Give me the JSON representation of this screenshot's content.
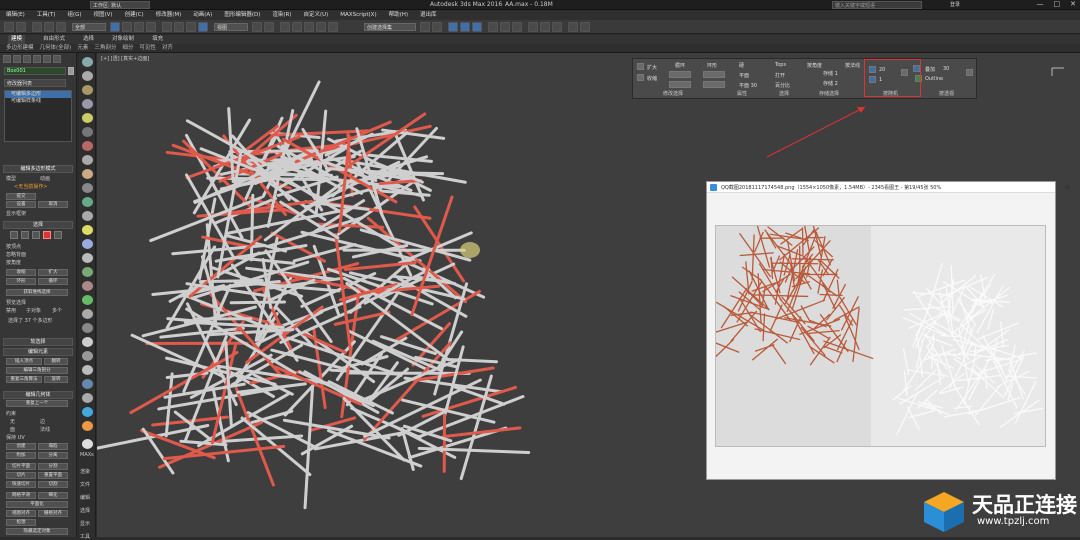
{
  "window": {
    "app_title": "Autodesk 3ds Max 2016",
    "file_title": "AA.max - 0.18M",
    "workspace": "工作区: 默认",
    "search_placeholder": "键入关键字或短语",
    "user": "登录",
    "controls": [
      "—",
      "□",
      "✕"
    ]
  },
  "menu": {
    "items": [
      "编辑(E)",
      "工具(T)",
      "组(G)",
      "视图(V)",
      "创建(C)",
      "修改器(M)",
      "动画(A)",
      "图形编辑器(D)",
      "渲染(R)",
      "自定义(U)",
      "MAXScript(X)",
      "帮助(H)",
      "退出库"
    ]
  },
  "toolbar": {
    "selection_filter": "全部",
    "view_select": "视图",
    "named_selection": "创建选择集"
  },
  "ribbon": {
    "tabs": [
      "建模",
      "自由形式",
      "选择",
      "对象绘制",
      "填充"
    ],
    "active_tab": "建模",
    "subtabs": [
      "多边形建模",
      "几何体(全部)",
      "元素",
      "三角剖分",
      "细分",
      "可见性",
      "对齐"
    ],
    "panel": {
      "expand": "扩大",
      "shrink": "收缩",
      "loop": "循环",
      "ring": "环形",
      "tops": "Tops",
      "open": "打开",
      "save1": "存储 1",
      "save2": "存储 2",
      "plane": "平面",
      "plane_30": "平面 30",
      "hard": "硬",
      "by_angle": "按角度",
      "by_normal": "按法线",
      "stretch": "百分比",
      "auto_value_1": "20",
      "auto_value_2": "1",
      "outline_value": "30",
      "outline": "Outline",
      "overlap": "叠加",
      "group_labels": [
        "修改选择",
        "属性",
        "选择",
        "存储选择",
        "按随机",
        "按透视"
      ]
    }
  },
  "command_panel": {
    "object_name": "Box001",
    "modifier_list": "修改器列表",
    "stack": [
      "可编辑多边形",
      "可编辑样条线"
    ],
    "edit_poly_mode": "编辑多边形模式",
    "model": "模型",
    "animate": "动画",
    "no_operation": "<无当前操作>",
    "commit": "提交",
    "settings": "设置",
    "cancel": "取消",
    "show_cage": "显示框架",
    "selection": "选择",
    "by_vertex": "按顶点",
    "ignore_backfacing": "忽略背面",
    "by_angle": "按角度",
    "shrink": "收缩",
    "grow": "扩大",
    "ring": "环形",
    "loop": "循环",
    "get_stack_selection": "获取堆栈选择",
    "preview_selection": "预览选择",
    "off": "禁用",
    "subobject": "子对象",
    "multi": "多个",
    "selected_count": "选择了 37 个多边形",
    "soft_selection": "软选择",
    "edit_elements": "编辑元素",
    "insert_vertex": "插入顶点",
    "flip": "翻转",
    "edit_triangulation": "编辑三角剖分",
    "retriangulate": "重复三角算法",
    "turn": "旋转",
    "edit_geometry": "编辑几何体",
    "repeat_last": "重复上一个",
    "constraints": "约束",
    "none": "无",
    "edge": "边",
    "face": "面",
    "normal": "法线",
    "preserve_uvs": "保持 UV",
    "create": "创建",
    "collapse": "塌陷",
    "attach": "附加",
    "detach": "分离",
    "slice_plane": "切片平面",
    "split": "分割",
    "slice": "切片",
    "reset_plane": "重置平面",
    "quickslice": "快速切片",
    "cut": "切割",
    "msmooth": "网格平滑",
    "tessellate": "细化",
    "make_planar": "平面化",
    "view_align": "视图对齐",
    "grid_align": "栅格对齐",
    "relax": "松弛",
    "hide_selected": "隐藏选定对象"
  },
  "side_icons": {
    "labels": [
      "MAXs",
      "渲染",
      "文件",
      "编辑",
      "选择",
      "显示",
      "工具"
    ]
  },
  "viewport": {
    "label": "[+] [透] [真实+边面]"
  },
  "viewer": {
    "title": "QQ截图20181117174548.png（1554×1050像素，1.54MB）- 2345看图王 - 第19/45张 50%",
    "controls": [
      "▭",
      "▢",
      "⛶",
      "—",
      "□",
      "✕"
    ]
  },
  "logo": {
    "brand": "天品正连接",
    "url": "www.tpzlj.com"
  },
  "colors": {
    "accent": "#3f6fa8",
    "annotation_red": "#dd3333",
    "rod_red": "#e05a4c",
    "rod_gray": "#cfcfcf"
  }
}
